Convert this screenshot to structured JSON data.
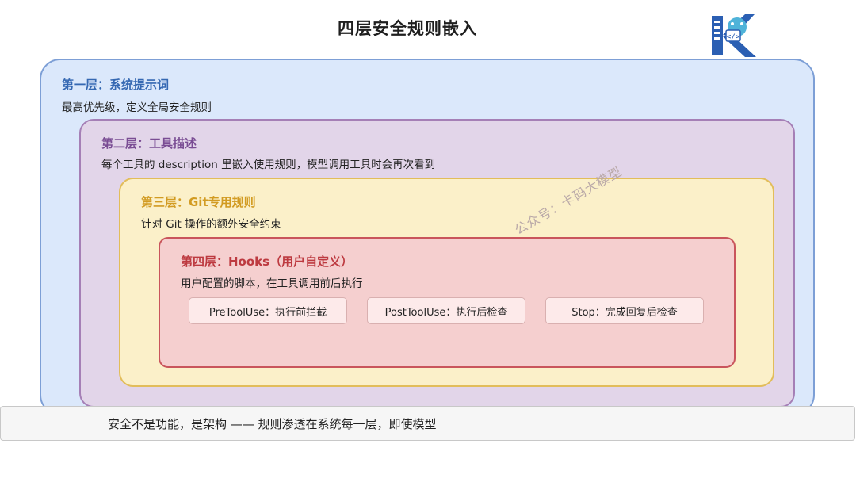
{
  "title": "四层安全规则嵌入",
  "logo": {
    "icon": "code-brain-logo-icon",
    "colors": {
      "primary": "#2b5fb3",
      "accent": "#4fb3d9"
    }
  },
  "layers": [
    {
      "title": "第一层：系统提示词",
      "desc": "最高优先级，定义全局安全规则",
      "color": "#3568b2"
    },
    {
      "title": "第二层：工具描述",
      "desc": "每个工具的 description 里嵌入使用规则，模型调用工具时会再次看到",
      "color": "#7a4d94"
    },
    {
      "title": "第三层：Git专用规则",
      "desc": "针对 Git 操作的额外安全约束",
      "color": "#d29b22"
    },
    {
      "title": "第四层：Hooks（用户自定义）",
      "desc": "用户配置的脚本，在工具调用前后执行",
      "color": "#bd3a40"
    }
  ],
  "hooks": [
    {
      "label": "PreToolUse：执行前拦截"
    },
    {
      "label": "PostToolUse：执行后检查"
    },
    {
      "label": "Stop：完成回复后检查"
    }
  ],
  "watermark": "公众号：卡码大模型",
  "caption": "安全不是功能，是架构 —— 规则渗透在系统每一层，即使模型"
}
